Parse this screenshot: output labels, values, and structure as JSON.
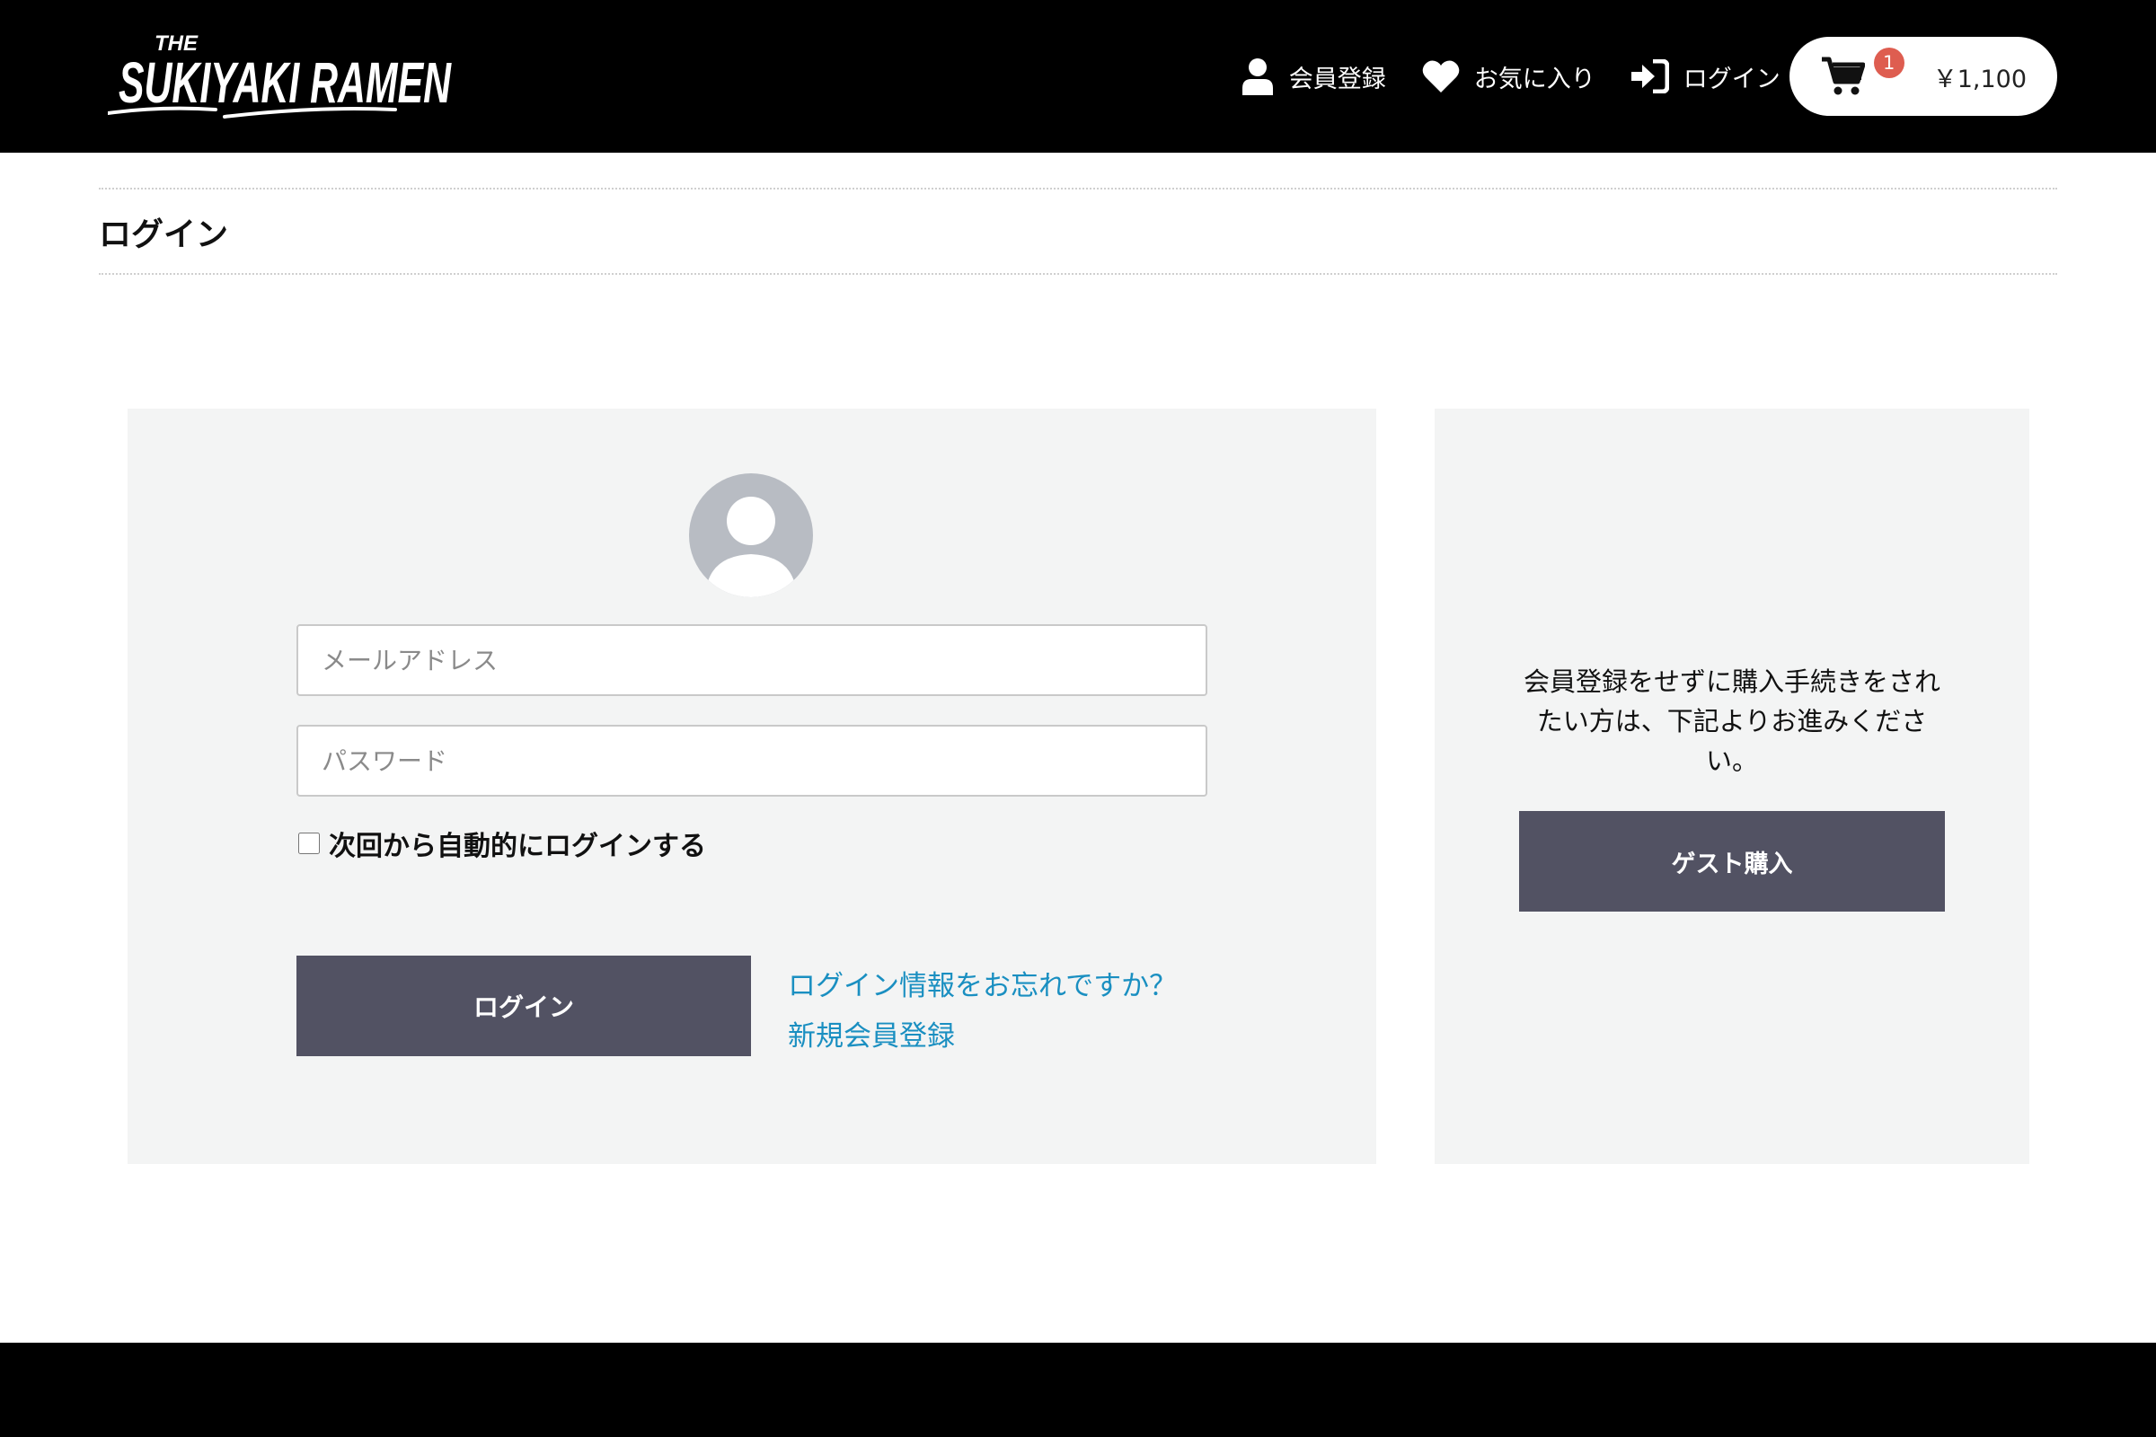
{
  "header": {
    "logo_text_small": "THE",
    "logo_text_main": "SUKIYAKI RAMEN",
    "nav": {
      "register_label": "会員登録",
      "favorites_label": "お気に入り",
      "login_label": "ログイン"
    },
    "cart": {
      "count": "1",
      "total": "￥1,100"
    }
  },
  "page": {
    "title": "ログイン"
  },
  "login_form": {
    "email_placeholder": "メールアドレス",
    "password_placeholder": "パスワード",
    "remember_label": "次回から自動的にログインする",
    "submit_label": "ログイン",
    "forgot_link": "ログイン情報をお忘れですか？",
    "register_link": "新規会員登録"
  },
  "guest": {
    "description": "会員登録をせずに購入手続きをされたい方は、下記よりお進みください。",
    "button_label": "ゲスト購入"
  },
  "colors": {
    "header_bg": "#000000",
    "panel_bg": "#f3f4f4",
    "button_bg": "#525263",
    "link": "#1a8fc1",
    "badge": "#de5d50"
  },
  "icons": {
    "register": "user-icon",
    "favorites": "heart-icon",
    "login": "sign-in-icon",
    "cart": "shopping-cart-icon",
    "avatar": "default-avatar-icon"
  }
}
